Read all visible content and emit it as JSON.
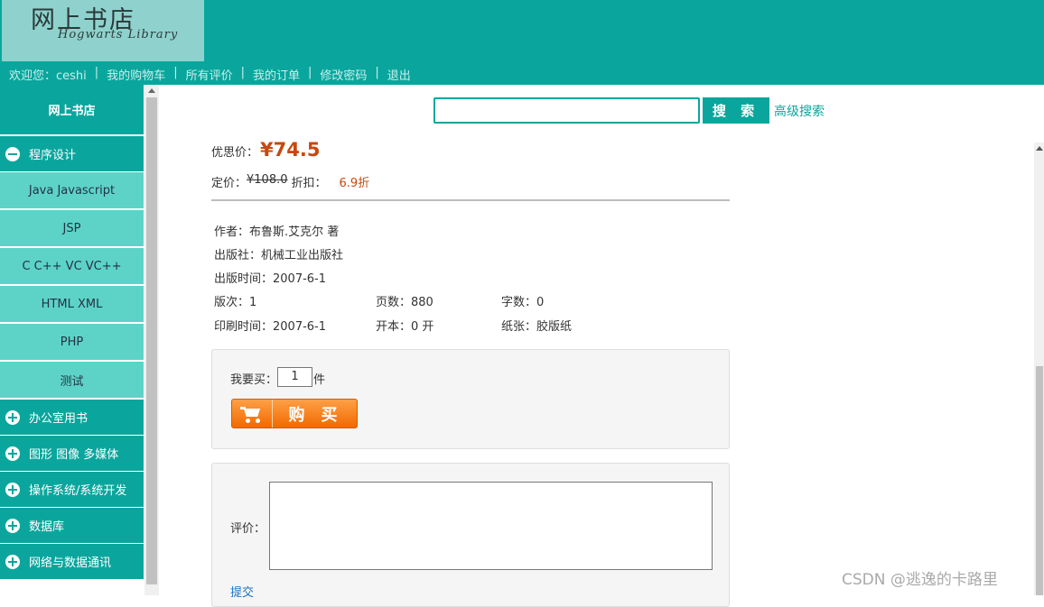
{
  "header": {
    "logo_cn": "网上书店",
    "logo_en": "Hogwarts Library",
    "nav": [
      "欢迎您：ceshi",
      "我的购物车",
      "所有评价",
      "我的订单",
      "修改密码",
      "退出"
    ]
  },
  "sidebar": {
    "title": "网上书店",
    "categories": [
      {
        "label": "程序设计",
        "expanded": true,
        "icon": "minus-circle-icon",
        "items": [
          "Java Javascript",
          "JSP",
          "C C++ VC VC++",
          "HTML XML",
          "PHP",
          "测试"
        ]
      },
      {
        "label": "办公室用书",
        "expanded": false,
        "icon": "plus-circle-icon"
      },
      {
        "label": "图形 图像 多媒体",
        "expanded": false,
        "icon": "plus-circle-icon"
      },
      {
        "label": "操作系统/系统开发",
        "expanded": false,
        "icon": "plus-circle-icon"
      },
      {
        "label": "数据库",
        "expanded": false,
        "icon": "plus-circle-icon"
      },
      {
        "label": "网络与数据通讯",
        "expanded": false,
        "icon": "plus-circle-icon"
      }
    ]
  },
  "search": {
    "value": "",
    "button": "搜 索",
    "advanced": "高级搜索"
  },
  "book": {
    "price_label": "优思价：",
    "price": "¥74.5",
    "list_label": "定价：",
    "list_price": "¥108.0",
    "discount_label": "折扣：",
    "discount": "6.9折",
    "author": "作者：布鲁斯.艾克尔 著",
    "publisher": "出版社：机械工业出版社",
    "pub_date": "出版时间：2007-6-1",
    "edition": "版次：1",
    "pages": "页数：880",
    "words": "字数：0",
    "print_date": "印刷时间：2007-6-1",
    "format": "开本：0 开",
    "paper": "纸张：胶版纸"
  },
  "buy": {
    "qty_label": "我要买：",
    "qty": "1",
    "unit": "件",
    "button": "购买"
  },
  "review": {
    "label": "评价：",
    "submit": "提交"
  },
  "watermark": "CSDN @逃逸的卡路里",
  "colors": {
    "brand": "#0aa69d",
    "sub_item": "#5dd3c8",
    "price": "#c7480e",
    "buy_button": "#f47c17"
  }
}
